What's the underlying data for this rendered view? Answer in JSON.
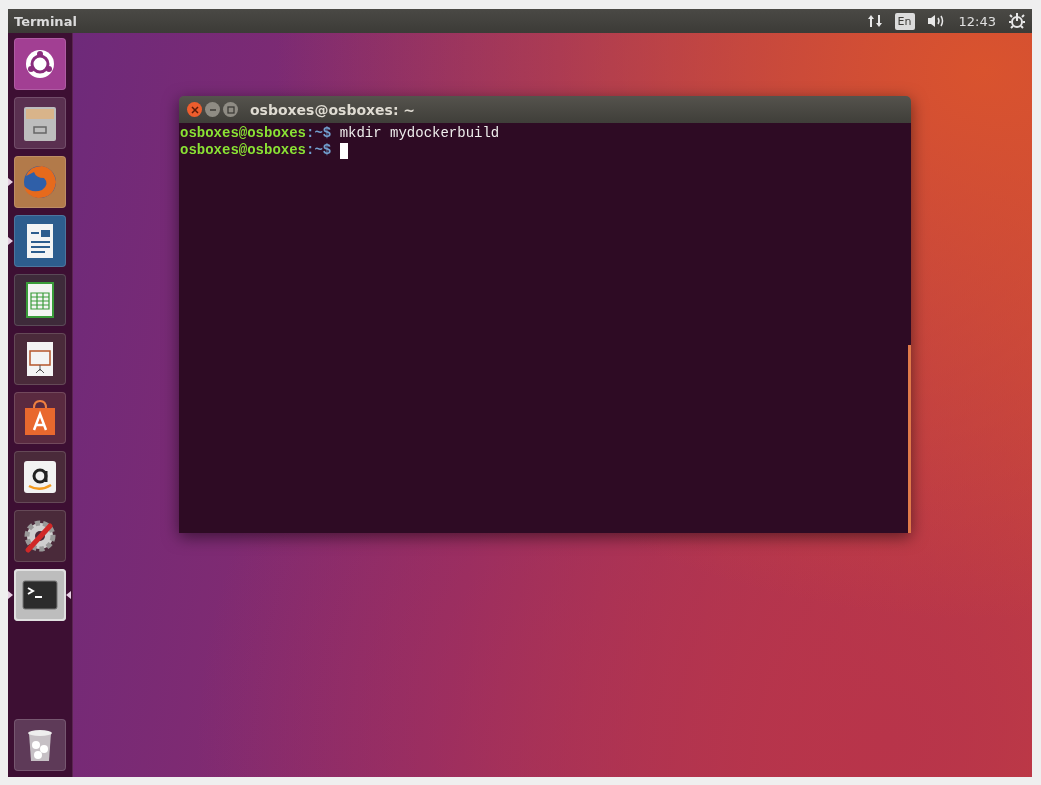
{
  "top_bar": {
    "title": "Terminal",
    "keyboard_layout": "En",
    "clock": "12:43"
  },
  "launcher": {
    "items": [
      {
        "kind": "dash",
        "running": false,
        "focused": false
      },
      {
        "kind": "files",
        "running": false,
        "focused": false
      },
      {
        "kind": "browser",
        "running": true,
        "focused": false
      },
      {
        "kind": "writer",
        "running": true,
        "focused": false
      },
      {
        "kind": "calc",
        "running": false,
        "focused": false
      },
      {
        "kind": "impress",
        "running": false,
        "focused": false
      },
      {
        "kind": "software",
        "running": false,
        "focused": false
      },
      {
        "kind": "shop",
        "running": false,
        "focused": false
      },
      {
        "kind": "settings",
        "running": false,
        "focused": false
      },
      {
        "kind": "terminal",
        "running": true,
        "focused": true
      }
    ],
    "trash": {
      "kind": "trash"
    }
  },
  "terminal": {
    "title": "osboxes@osboxes: ~",
    "lines": [
      {
        "user_host": "osboxes@osboxes",
        "path": ":~$",
        "command": "mkdir mydockerbuild",
        "cursor": false
      },
      {
        "user_host": "osboxes@osboxes",
        "path": ":~$",
        "cursor": true
      }
    ]
  }
}
